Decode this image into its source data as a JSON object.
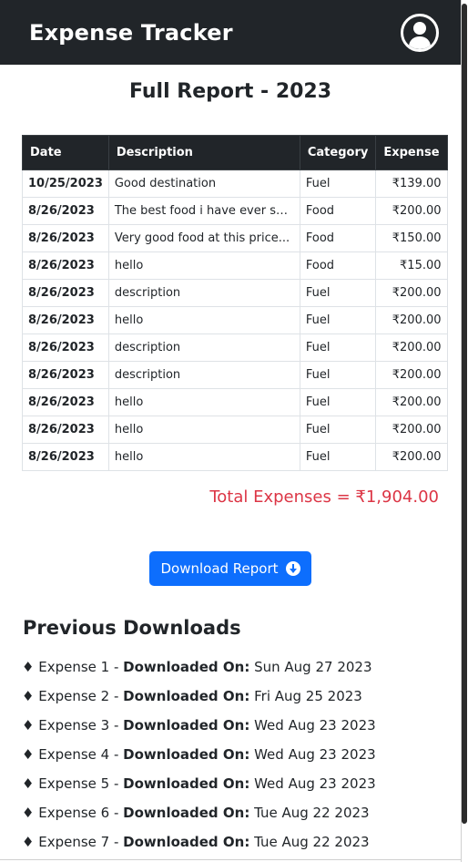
{
  "navbar": {
    "brand": "Expense Tracker",
    "profile_icon": "user-circle-icon"
  },
  "report": {
    "title": "Full Report - 2023",
    "columns": [
      "Date",
      "Description",
      "Category",
      "Expense"
    ],
    "rows": [
      {
        "date": "10/25/2023",
        "description": "Good destination",
        "category": "Fuel",
        "expense": "₹139.00"
      },
      {
        "date": "8/26/2023",
        "description": "The best food i have ever seen",
        "category": "Food",
        "expense": "₹200.00"
      },
      {
        "date": "8/26/2023",
        "description": "Very good food at this price...",
        "category": "Food",
        "expense": "₹150.00"
      },
      {
        "date": "8/26/2023",
        "description": "hello",
        "category": "Food",
        "expense": "₹15.00"
      },
      {
        "date": "8/26/2023",
        "description": "description",
        "category": "Fuel",
        "expense": "₹200.00"
      },
      {
        "date": "8/26/2023",
        "description": "hello",
        "category": "Fuel",
        "expense": "₹200.00"
      },
      {
        "date": "8/26/2023",
        "description": "description",
        "category": "Fuel",
        "expense": "₹200.00"
      },
      {
        "date": "8/26/2023",
        "description": "description",
        "category": "Fuel",
        "expense": "₹200.00"
      },
      {
        "date": "8/26/2023",
        "description": "hello",
        "category": "Fuel",
        "expense": "₹200.00"
      },
      {
        "date": "8/26/2023",
        "description": "hello",
        "category": "Fuel",
        "expense": "₹200.00"
      },
      {
        "date": "8/26/2023",
        "description": "hello",
        "category": "Fuel",
        "expense": "₹200.00"
      }
    ],
    "total": "Total Expenses = ₹1,904.00"
  },
  "download_button": {
    "label": "Download Report",
    "icon": "download-circle-icon"
  },
  "previous": {
    "title": "Previous Downloads",
    "bullet": "♦",
    "downloaded_label": "Downloaded On:",
    "items": [
      {
        "name": "Expense 1",
        "date": "Sun Aug 27 2023"
      },
      {
        "name": "Expense 2",
        "date": "Fri Aug 25 2023"
      },
      {
        "name": "Expense 3",
        "date": "Wed Aug 23 2023"
      },
      {
        "name": "Expense 4",
        "date": "Wed Aug 23 2023"
      },
      {
        "name": "Expense 5",
        "date": "Wed Aug 23 2023"
      },
      {
        "name": "Expense 6",
        "date": "Tue Aug 22 2023"
      },
      {
        "name": "Expense 7",
        "date": "Tue Aug 22 2023"
      }
    ]
  },
  "colors": {
    "navbar": "#212529",
    "primary": "#0d6efd",
    "danger": "#dc3545"
  }
}
